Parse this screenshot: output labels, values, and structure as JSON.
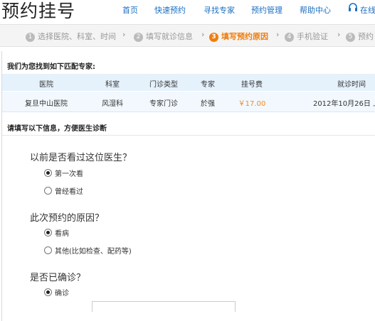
{
  "header": {
    "logo": "预约挂号",
    "nav": [
      "首页",
      "快速预约",
      "寻找专家",
      "预约管理",
      "帮助中心"
    ],
    "online_label": "在线"
  },
  "steps": [
    {
      "num": "1",
      "label": "选择医院、科室、时间",
      "active": false
    },
    {
      "num": "2",
      "label": "填写就诊信息",
      "active": false
    },
    {
      "num": "3",
      "label": "填写预约原因",
      "active": true
    },
    {
      "num": "4",
      "label": "手机验证",
      "active": false
    },
    {
      "num": "5",
      "label": "预约",
      "active": false
    }
  ],
  "step_separator": "›",
  "match": {
    "title": "我们为您找到如下匹配专家:",
    "columns": [
      "医院",
      "科室",
      "门诊类型",
      "专家",
      "挂号费",
      "就诊时间"
    ],
    "row": [
      "复旦中山医院",
      "风湿科",
      "专家门诊",
      "於强",
      "￥17.00",
      "2012年10月26日 上"
    ]
  },
  "form": {
    "title": "请填写以下信息，方便医生诊断",
    "questions": [
      {
        "label": "以前是否看过这位医生？",
        "options": [
          "第一次看",
          "曾经看过"
        ],
        "selected": 0
      },
      {
        "label": "此次预约的原因？",
        "options": [
          "看病",
          "其他(比如检查、配药等)"
        ],
        "selected": 0
      },
      {
        "label": "是否已确诊？",
        "options": [
          "确诊"
        ],
        "selected": 0
      }
    ]
  },
  "colors": {
    "accent": "#f07d0a",
    "link": "#1a6fc0",
    "table_head": "#e5f1fb"
  }
}
